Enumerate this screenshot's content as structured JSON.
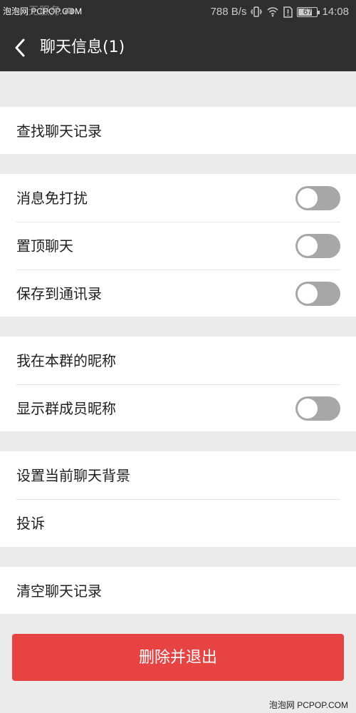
{
  "status_bar": {
    "watermark": "泡泡网 PCPOP.COM",
    "carrier": "无服务",
    "network_speed": "788 B/s",
    "battery_level": "67",
    "time": "14:08",
    "icons": {
      "carrier_status": "cloud-alert-icon",
      "vibrate": "vibrate-icon",
      "wifi": "wifi-icon",
      "sim_alert": "sim-alert-icon",
      "battery": "battery-icon"
    }
  },
  "header": {
    "title": "聊天信息(1)",
    "back_icon": "back-arrow-icon"
  },
  "settings": [
    {
      "id": "search",
      "items": [
        {
          "label": "查找聊天记录"
        }
      ]
    },
    {
      "id": "chat-options",
      "items": [
        {
          "label": "消息免打扰",
          "toggle": false
        },
        {
          "label": "置顶聊天",
          "toggle": false
        },
        {
          "label": "保存到通讯录",
          "toggle": false
        }
      ]
    },
    {
      "id": "group-display",
      "items": [
        {
          "label": "我在本群的昵称"
        },
        {
          "label": "显示群成员昵称",
          "toggle": false
        }
      ]
    },
    {
      "id": "background-and-report",
      "items": [
        {
          "label": "设置当前聊天背景"
        },
        {
          "label": "投诉"
        }
      ]
    },
    {
      "id": "clear",
      "items": [
        {
          "label": "清空聊天记录"
        }
      ]
    }
  ],
  "actions": {
    "delete_exit": "删除并退出"
  },
  "footer": {
    "watermark": "泡泡网 PCPOP.COM"
  },
  "colors": {
    "header_background": "#2f2f2f",
    "page_background": "#ebebeb",
    "danger_button": "#e84343",
    "toggle_off": "#a7a7a7"
  }
}
